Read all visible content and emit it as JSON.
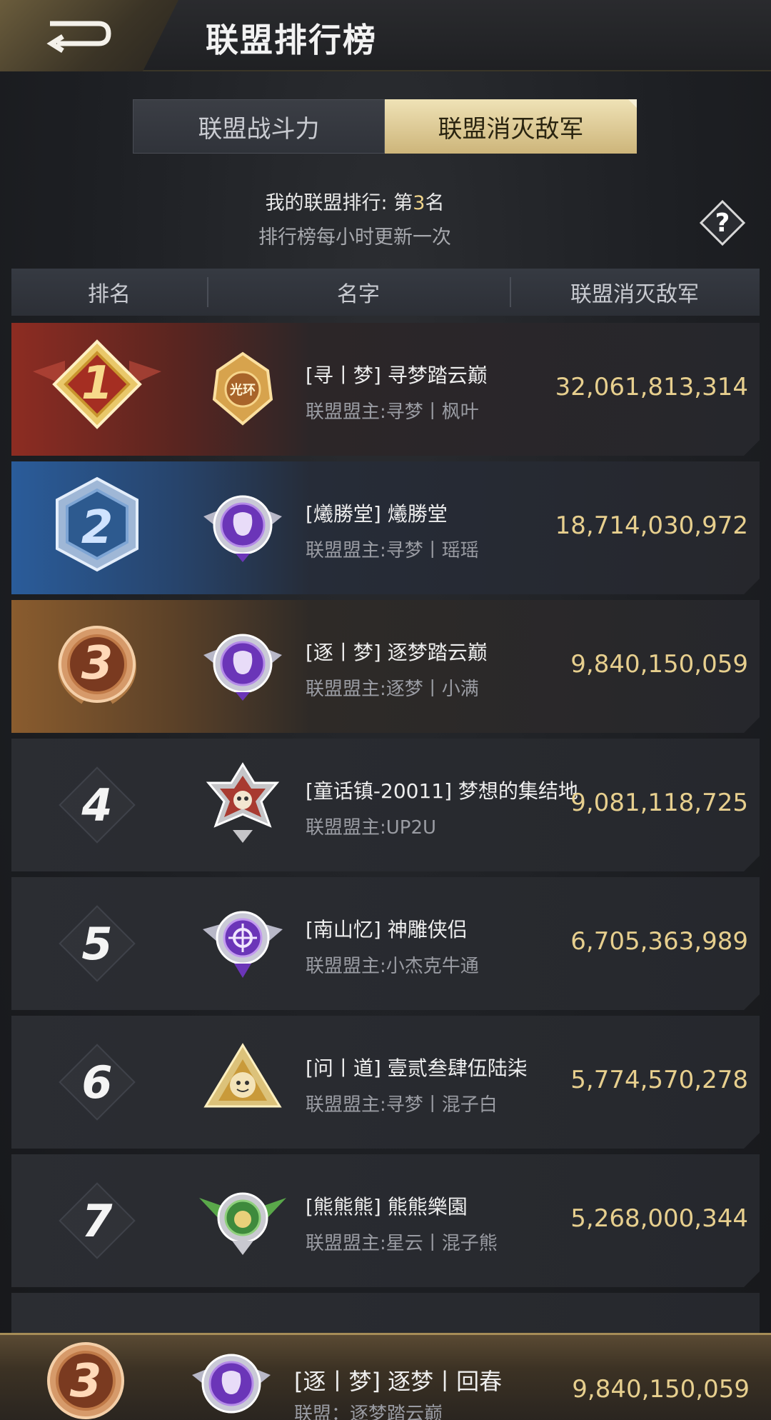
{
  "header": {
    "title": "联盟排行榜"
  },
  "tabs": [
    {
      "label": "联盟战斗力",
      "active": false
    },
    {
      "label": "联盟消灭敌军",
      "active": true
    }
  ],
  "info": {
    "my_rank_prefix": "我的联盟排行: 第",
    "my_rank_value": "3",
    "my_rank_suffix": "名",
    "update_note": "排行榜每小时更新一次"
  },
  "columns": {
    "rank": "排名",
    "name": "名字",
    "kills": "联盟消灭敌军"
  },
  "rows": [
    {
      "rank": "1",
      "name": "[寻丨梦] 寻梦踏云巅",
      "leader": "联盟盟主:寻梦丨枫叶",
      "value": "32,061,813,314",
      "emblem": "gold-crest-icon"
    },
    {
      "rank": "2",
      "name": "[爔勝堂] 爔勝堂",
      "leader": "联盟盟主:寻梦丨瑶瑶",
      "value": "18,714,030,972",
      "emblem": "purple-lion-icon"
    },
    {
      "rank": "3",
      "name": "[逐丨梦] 逐梦踏云巅",
      "leader": "联盟盟主:逐梦丨小满",
      "value": "9,840,150,059",
      "emblem": "purple-lion-icon"
    },
    {
      "rank": "4",
      "name": "[童话镇-20011] 梦想的集结地",
      "leader": "联盟盟主:UP2U",
      "value": "9,081,118,725",
      "emblem": "red-skull-icon"
    },
    {
      "rank": "5",
      "name": "[南山忆] 神雕侠侣",
      "leader": "联盟盟主:小杰克牛通",
      "value": "6,705,363,989",
      "emblem": "purple-crosshair-icon"
    },
    {
      "rank": "6",
      "name": "[问丨道] 壹贰叁肆伍陆柒",
      "leader": "联盟盟主:寻梦丨混子白",
      "value": "5,774,570,278",
      "emblem": "gold-tiger-icon"
    },
    {
      "rank": "7",
      "name": "[熊熊熊] 熊熊樂園",
      "leader": "联盟盟主:星云丨混子熊",
      "value": "5,268,000,344",
      "emblem": "green-bear-icon"
    }
  ],
  "my_alliance": {
    "rank": "3",
    "name": "[逐丨梦] 逐梦丨回春",
    "leader": "联盟：逐梦踏云巅",
    "value": "9,840,150,059"
  },
  "colors": {
    "rank1": "#8d2c22",
    "rank2": "#2a5c9a",
    "rank3": "#8a5c2e",
    "value_gold": "#e7cf8e",
    "tab_active": "#e3d098"
  }
}
